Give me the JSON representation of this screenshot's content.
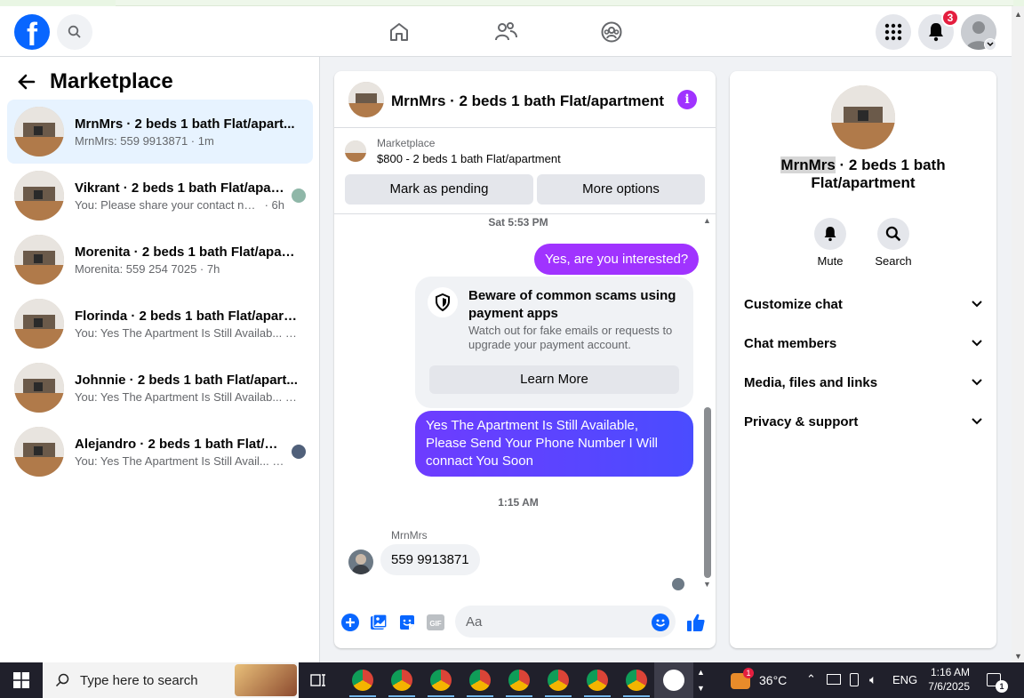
{
  "header": {
    "logo_letter": "f",
    "notification_count": "3"
  },
  "sidebar": {
    "title": "Marketplace",
    "conversations": [
      {
        "name": "MrnMrs · 2 beds 1 bath Flat/apart...",
        "preview": "MrnMrs: 559 9913871 · 1m",
        "active": true
      },
      {
        "name": "Vikrant · 2 beds 1 bath Flat/apar...",
        "preview": "You: Please share your contact nu...",
        "time": "· 6h"
      },
      {
        "name": "Morenita · 2 beds 1 bath Flat/apart...",
        "preview": "Morenita: 559 254 7025 · 7h"
      },
      {
        "name": "Florinda · 2 beds 1 bath Flat/apart...",
        "preview": "You: Yes The Apartment Is Still Availab... · 7h"
      },
      {
        "name": "Johnnie · 2 beds 1 bath Flat/apart...",
        "preview": "You: Yes The Apartment Is Still Availab... · 7h"
      },
      {
        "name": "Alejandro · 2 beds 1 bath Flat/ap...",
        "preview": "You: Yes The Apartment Is Still Avail... · 7h"
      }
    ]
  },
  "chat": {
    "title": "MrnMrs · 2 beds 1 bath Flat/apartment",
    "marketplace_label": "Marketplace",
    "listing": "$800 - 2 beds 1 bath Flat/apartment",
    "mark_pending": "Mark as pending",
    "more_options": "More options",
    "timestamp1": "Sat 5:53 PM",
    "msg1": "Yes, are you interested?",
    "scam_title": "Beware of common scams using payment apps",
    "scam_text": "Watch out for fake emails or requests to upgrade your payment account.",
    "learn_more": "Learn More",
    "msg2": "Yes The Apartment Is Still Available, Please Send Your Phone Number I Will connact You Soon",
    "timestamp2": "1:15 AM",
    "sender": "MrnMrs",
    "msg3": "559 9913871",
    "composer_placeholder": "Aa"
  },
  "details": {
    "name_highlight": "MrnMrs",
    "title_rest": " · 2 beds 1 bath Flat/apartment",
    "mute": "Mute",
    "search": "Search",
    "sections": [
      "Customize chat",
      "Chat members",
      "Media, files and links",
      "Privacy & support"
    ]
  },
  "taskbar": {
    "search_placeholder": "Type here to search",
    "temperature": "36°C",
    "language": "ENG",
    "time": "1:16 AM",
    "date": "7/6/2025",
    "notif_count": "1",
    "weather_badge": "1"
  },
  "colors": {
    "accent_purple": "#a033ff",
    "accent_blue": "#0866ff",
    "badge_red": "#e41e3f"
  },
  "icons": [
    "home-icon",
    "friends-icon",
    "groups-icon",
    "apps-grid-icon",
    "bell-icon",
    "search-icon",
    "back-arrow-icon",
    "info-icon",
    "shield-icon",
    "plus-icon",
    "photo-icon",
    "sticker-icon",
    "gif-icon",
    "emoji-icon",
    "like-icon",
    "chevron-down-icon",
    "windows-icon"
  ]
}
